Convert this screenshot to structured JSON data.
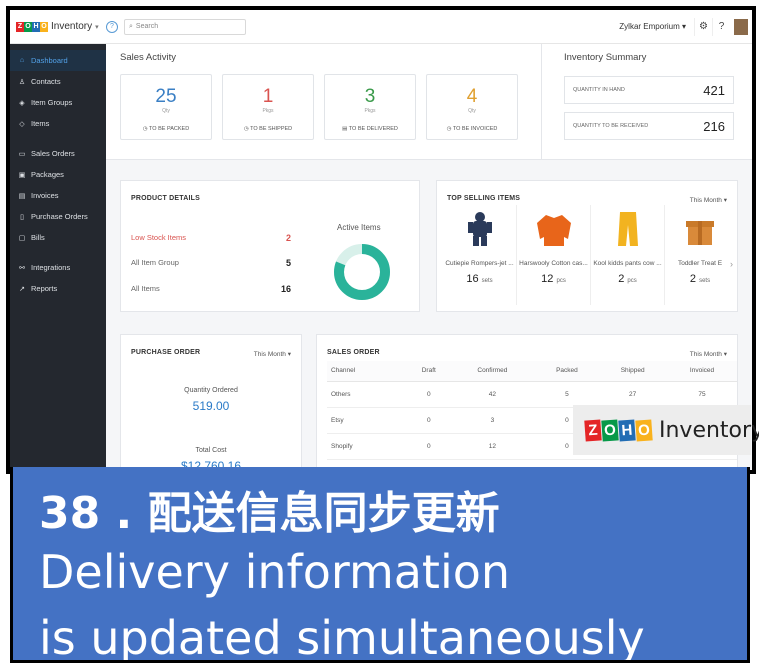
{
  "app": {
    "brand": "ZOHO",
    "name": "Inventory",
    "search_placeholder": "Search",
    "org": "Zylkar Emporium"
  },
  "sidebar": {
    "items": [
      {
        "label": "Dashboard",
        "icon": "home-icon"
      },
      {
        "label": "Contacts",
        "icon": "user-icon"
      },
      {
        "label": "Item Groups",
        "icon": "item-groups-icon"
      },
      {
        "label": "Items",
        "icon": "items-icon"
      },
      {
        "label": "Sales Orders",
        "icon": "sales-orders-icon"
      },
      {
        "label": "Packages",
        "icon": "packages-icon"
      },
      {
        "label": "Invoices",
        "icon": "invoices-icon"
      },
      {
        "label": "Purchase Orders",
        "icon": "purchase-orders-icon"
      },
      {
        "label": "Bills",
        "icon": "bills-icon"
      },
      {
        "label": "Integrations",
        "icon": "integrations-icon"
      },
      {
        "label": "Reports",
        "icon": "reports-icon"
      }
    ]
  },
  "sales_activity": {
    "title": "Sales Activity",
    "cards": [
      {
        "value": "25",
        "unit": "Qty",
        "label": "TO BE PACKED",
        "color": "#3a7fc4"
      },
      {
        "value": "1",
        "unit": "Pkgs",
        "label": "TO BE SHIPPED",
        "color": "#d9534f"
      },
      {
        "value": "3",
        "unit": "Pkgs",
        "label": "TO BE DELIVERED",
        "color": "#3a9a4a"
      },
      {
        "value": "4",
        "unit": "Qty",
        "label": "TO BE INVOICED",
        "color": "#e0a030"
      }
    ]
  },
  "inventory_summary": {
    "title": "Inventory Summary",
    "rows": [
      {
        "label": "QUANTITY IN HAND",
        "value": "421"
      },
      {
        "label": "QUANTITY TO BE RECEIVED",
        "value": "216"
      }
    ]
  },
  "product_details": {
    "title": "PRODUCT DETAILS",
    "rows": [
      {
        "label": "Low Stock Items",
        "value": "2"
      },
      {
        "label": "All Item Group",
        "value": "5"
      },
      {
        "label": "All Items",
        "value": "16"
      }
    ],
    "active_items_label": "Active Items",
    "active_items_percent": "81%",
    "active_items_fraction": 0.81
  },
  "top_selling": {
    "title": "TOP SELLING ITEMS",
    "period": "This Month",
    "items": [
      {
        "name": "Cutiepie Rompers-jet ...",
        "qty": "16",
        "unit": "sets",
        "icon": "romper-icon"
      },
      {
        "name": "Harswooly Cotton cas...",
        "qty": "12",
        "unit": "pcs",
        "icon": "sweater-icon"
      },
      {
        "name": "Kool kidds pants cow ...",
        "qty": "2",
        "unit": "pcs",
        "icon": "pants-icon"
      },
      {
        "name": "Toddler Treat E",
        "qty": "2",
        "unit": "sets",
        "icon": "gift-box-icon"
      }
    ]
  },
  "purchase_order": {
    "title": "PURCHASE ORDER",
    "period": "This Month",
    "qty_label": "Quantity Ordered",
    "qty_value": "519.00",
    "cost_label": "Total Cost",
    "cost_value": "$12,760.16"
  },
  "sales_order": {
    "title": "SALES ORDER",
    "period": "This Month",
    "columns": [
      "Channel",
      "Draft",
      "Confirmed",
      "Packed",
      "Shipped",
      "Invoiced"
    ],
    "rows": [
      [
        "Others",
        "0",
        "42",
        "5",
        "27",
        "75"
      ],
      [
        "Etsy",
        "0",
        "3",
        "0",
        "",
        ""
      ],
      [
        "Shopify",
        "0",
        "12",
        "0",
        "",
        ""
      ]
    ]
  },
  "watermark": {
    "brand": "ZOHO",
    "word": "Inventory"
  },
  "caption": {
    "line1": "38 . 配送信息同步更新",
    "line2": "Delivery information",
    "line3": "is updated simultaneously"
  }
}
